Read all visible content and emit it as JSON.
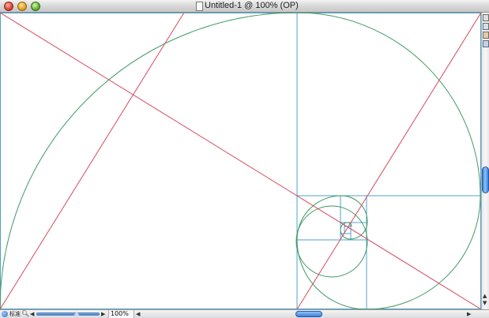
{
  "window": {
    "title": "Untitled-1 @ 100% (OP)",
    "buttons": {
      "close": "close",
      "minimize": "minimize",
      "zoom": "zoom"
    }
  },
  "icons": {
    "close": "close-icon",
    "minimize": "minimize-icon",
    "zoom": "zoom-icon",
    "document": "document-icon",
    "zoom_tool": "magnifier-icon",
    "arrow_left": "◀",
    "arrow_right": "▶",
    "arrow_up": "▲",
    "arrow_down": "▼"
  },
  "statusbar": {
    "mode_label": "标准",
    "zoom_value": "100%"
  },
  "colors": {
    "red_line": "#d64a5e",
    "spiral": "#3f9a63",
    "blue_rect": "#4fa3c8"
  }
}
